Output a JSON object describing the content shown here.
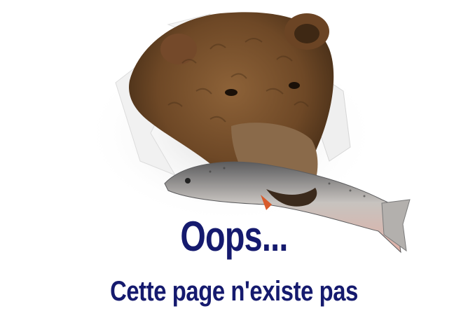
{
  "error": {
    "headline": "Oops...",
    "message": "Cette page n'existe pas"
  },
  "illustration": {
    "subject": "bear-with-fish-tearing-paper",
    "colors": {
      "fur": "#7a5230",
      "fur_dark": "#3e2814",
      "fish_body": "#c9c4c0",
      "fish_back": "#6b6a6a",
      "fish_belly": "#d9a8a0",
      "paper_shadow": "#d8d8d8"
    }
  },
  "colors": {
    "text": "#151a6e",
    "background": "#ffffff"
  }
}
